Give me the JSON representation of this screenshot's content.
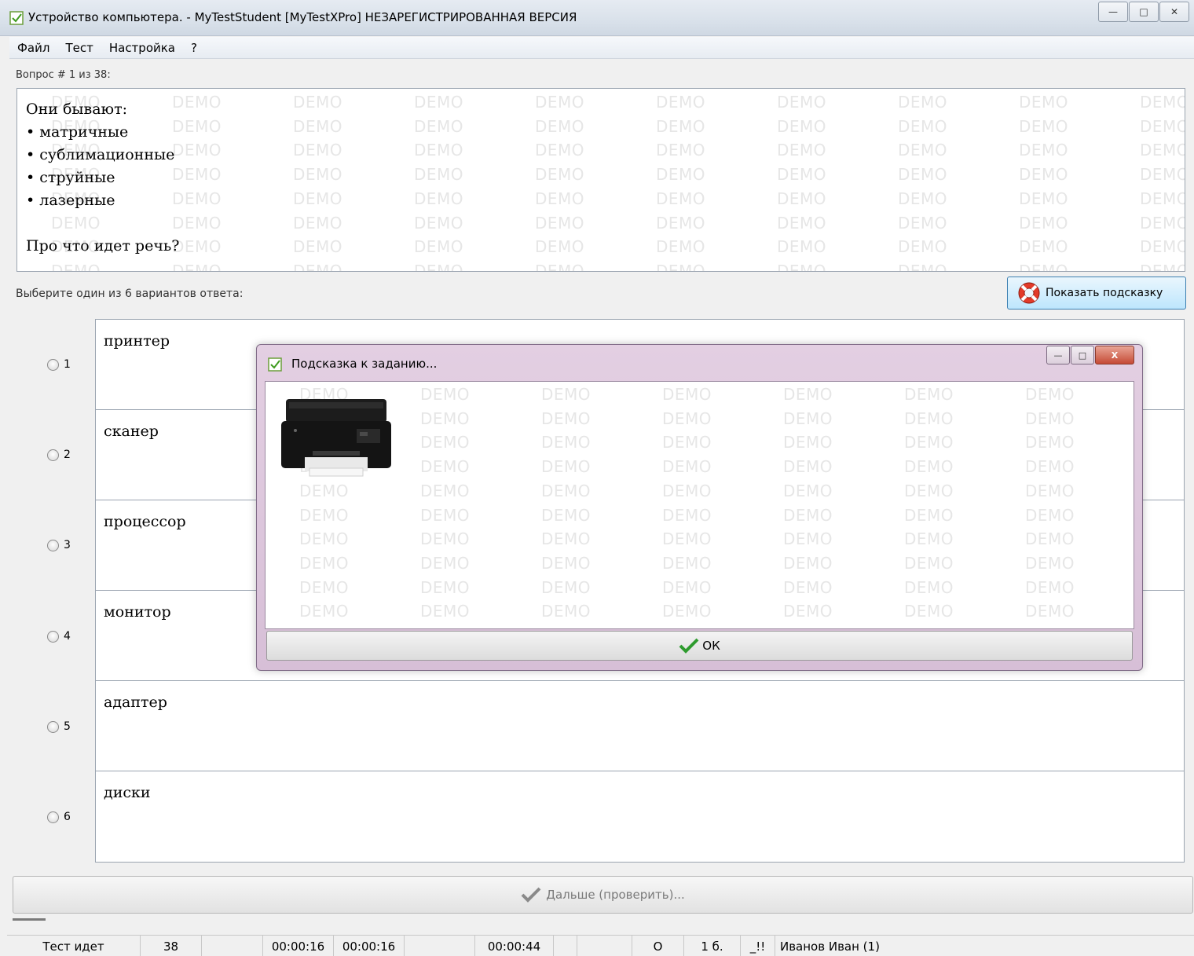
{
  "window": {
    "title": "Устройство компьютера. - MyTestStudent [MyTestXPro] НЕЗАРЕГИСТРИРОВАННАЯ ВЕРСИЯ",
    "minimize": "—",
    "maximize": "□",
    "close": "✕"
  },
  "menu": [
    "Файл",
    "Тест",
    "Настройка",
    "?"
  ],
  "question": {
    "counter": "Вопрос # 1 из 38:",
    "lines": [
      "Они бывают:",
      "• матричные",
      "• сублимационные",
      "• струйные",
      "• лазерные",
      "Про что идет речь?"
    ]
  },
  "watermark": "DEMO",
  "choose_label": "Выберите один из 6 вариантов ответа:",
  "hint_button": "Показать подсказку",
  "answers": [
    {
      "num": "1",
      "text": "принтер"
    },
    {
      "num": "2",
      "text": "сканер"
    },
    {
      "num": "3",
      "text": "процессор"
    },
    {
      "num": "4",
      "text": "монитор"
    },
    {
      "num": "5",
      "text": "адаптер"
    },
    {
      "num": "6",
      "text": "диски"
    }
  ],
  "next_button": "Дальше (проверить)...",
  "status": {
    "state": "Тест идет",
    "count": "38",
    "time1": "00:00:16",
    "time2": "00:00:16",
    "time3": "00:00:44",
    "o": "O",
    "score": "1 б.",
    "flag": "_!!",
    "user": "Иванов Иван (1)"
  },
  "dialog": {
    "title": "Подсказка к заданию...",
    "ok": "ОК",
    "minimize": "—",
    "maximize": "□",
    "close": "X"
  },
  "colors": {
    "dialog_frame": "#d9c2d9",
    "hint_button_bg": "#bde6fd",
    "check_green": "#2e9b2e"
  }
}
